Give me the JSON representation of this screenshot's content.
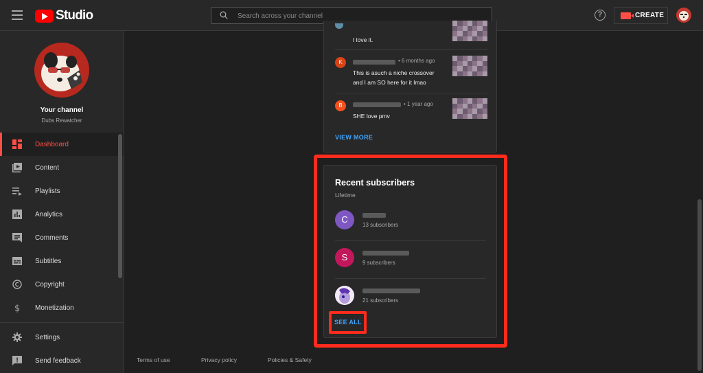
{
  "header": {
    "logo_text": "Studio",
    "search_placeholder": "Search across your channel",
    "create_label": "CREATE"
  },
  "sidebar": {
    "channel_title": "Your channel",
    "channel_name": "Dubs Rewatcher",
    "items": [
      {
        "label": "Dashboard",
        "icon": "dashboard-icon",
        "active": true
      },
      {
        "label": "Content",
        "icon": "content-icon"
      },
      {
        "label": "Playlists",
        "icon": "playlists-icon"
      },
      {
        "label": "Analytics",
        "icon": "analytics-icon"
      },
      {
        "label": "Comments",
        "icon": "comments-icon"
      },
      {
        "label": "Subtitles",
        "icon": "subtitles-icon"
      },
      {
        "label": "Copyright",
        "icon": "copyright-icon"
      },
      {
        "label": "Monetization",
        "icon": "monetization-icon"
      }
    ],
    "bottom_items": [
      {
        "label": "Settings",
        "icon": "settings-icon"
      },
      {
        "label": "Send feedback",
        "icon": "feedback-icon"
      }
    ]
  },
  "comments": {
    "items": [
      {
        "initial": "",
        "time": "",
        "text": "I love it.",
        "color": "#5f8fa8"
      },
      {
        "initial": "K",
        "time": "• 6 months ago",
        "text": "This is asuch a niche crossover and I am SO here for it lmao",
        "color": "#d84315"
      },
      {
        "initial": "B",
        "time": "• 1 year ago",
        "text": "SHE love pmv",
        "color": "#f4511e"
      }
    ],
    "view_more": "VIEW MORE"
  },
  "subscribers": {
    "title": "Recent subscribers",
    "period": "Lifetime",
    "items": [
      {
        "initial": "C",
        "count": "13 subscribers",
        "color": "#7e57c2"
      },
      {
        "initial": "S",
        "count": "9 subscribers",
        "color": "#c2185b"
      },
      {
        "initial": "",
        "count": "21 subscribers",
        "color": "#9575cd"
      }
    ],
    "see_all": "SEE ALL"
  },
  "footer": {
    "terms": "Terms of use",
    "privacy": "Privacy policy",
    "policies": "Policies & Safety"
  }
}
